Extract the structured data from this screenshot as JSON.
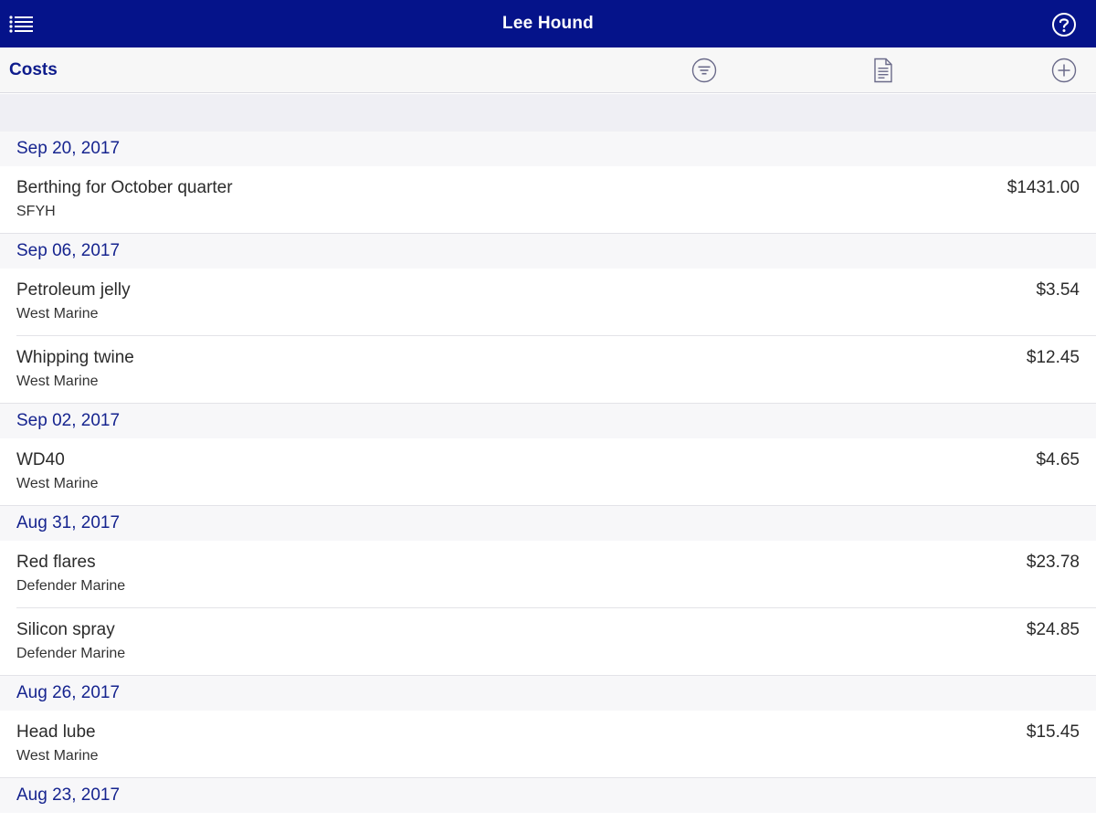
{
  "header": {
    "title": "Lee Hound",
    "menu_icon": "list-menu-icon",
    "help_icon": "question-circle-icon"
  },
  "toolbar": {
    "section_title": "Costs",
    "filter_icon": "filter-circle-icon",
    "report_icon": "document-icon",
    "add_icon": "plus-circle-icon"
  },
  "colors": {
    "title_bar": "#05138a",
    "accent": "#0e1c8c",
    "toolbar_bg": "#f7f7f7",
    "spacer_bg": "#efeff4",
    "icon": "#6b6b8a"
  },
  "groups": [
    {
      "date": "Sep 20, 2017",
      "items": [
        {
          "title": "Berthing for October quarter",
          "vendor": "SFYH",
          "amount": "$1431.00"
        }
      ]
    },
    {
      "date": "Sep 06, 2017",
      "items": [
        {
          "title": "Petroleum jelly",
          "vendor": "West Marine",
          "amount": "$3.54"
        },
        {
          "title": "Whipping twine",
          "vendor": "West Marine",
          "amount": "$12.45"
        }
      ]
    },
    {
      "date": "Sep 02, 2017",
      "items": [
        {
          "title": "WD40",
          "vendor": "West Marine",
          "amount": "$4.65"
        }
      ]
    },
    {
      "date": "Aug 31, 2017",
      "items": [
        {
          "title": "Red flares",
          "vendor": "Defender Marine",
          "amount": "$23.78"
        },
        {
          "title": "Silicon spray",
          "vendor": "Defender Marine",
          "amount": "$24.85"
        }
      ]
    },
    {
      "date": "Aug 26, 2017",
      "items": [
        {
          "title": "Head lube",
          "vendor": "West Marine",
          "amount": "$15.45"
        }
      ]
    },
    {
      "date": "Aug 23, 2017",
      "items": []
    }
  ]
}
